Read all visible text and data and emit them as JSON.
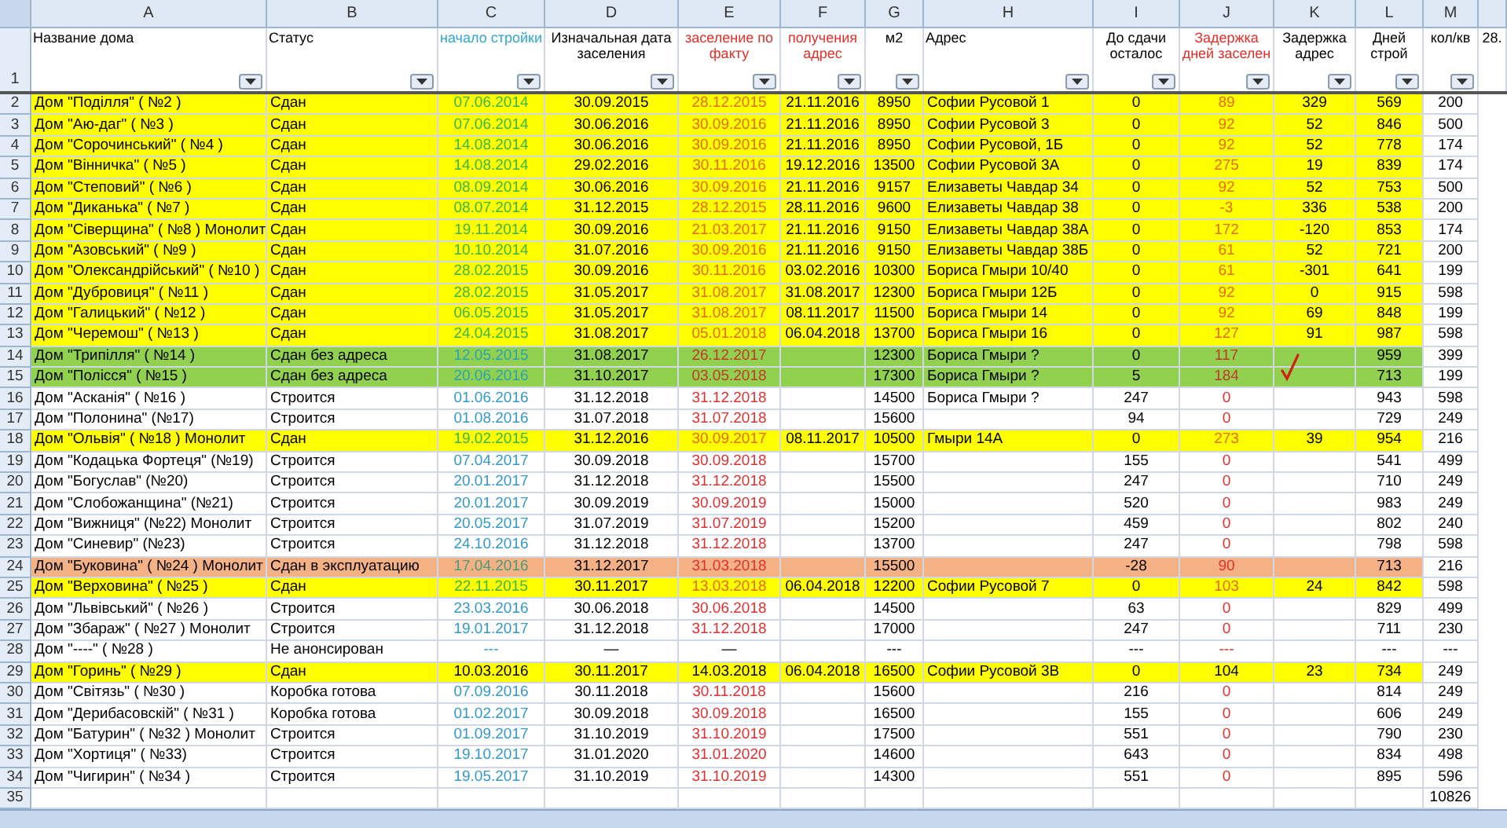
{
  "header_row_number": "1",
  "columns": [
    {
      "letter": "A",
      "label": "Название дома",
      "filter": true
    },
    {
      "letter": "B",
      "label": "Статус",
      "filter": true
    },
    {
      "letter": "C",
      "label": "начало стройки",
      "color": "#2ea6d6",
      "filter": true
    },
    {
      "letter": "D",
      "label": "Изначальная дата заселения",
      "filter": true
    },
    {
      "letter": "E",
      "label": "заселение по факту",
      "color": "#e0302a",
      "filter": true
    },
    {
      "letter": "F",
      "label": "получения адрес",
      "color": "#e0302a",
      "filter": true
    },
    {
      "letter": "G",
      "label": "м2",
      "filter": true
    },
    {
      "letter": "H",
      "label": "Адрес",
      "filter": true
    },
    {
      "letter": "I",
      "label": "До сдачи осталос",
      "filter": true
    },
    {
      "letter": "J",
      "label": "Задержка дней заселен",
      "color": "#e0302a",
      "filter": true
    },
    {
      "letter": "K",
      "label": "Задержка адрес",
      "filter": true
    },
    {
      "letter": "L",
      "label": "Дней строй",
      "filter": true
    },
    {
      "letter": "M",
      "label": "кол/кв",
      "filter": true
    },
    {
      "label": "28.",
      "filter": false
    }
  ],
  "rows": [
    {
      "row": "2",
      "kind": "handed",
      "tick": false,
      "cells": {
        "A": "Дом \"Поділля\" ( №2 )",
        "B": "Сдан",
        "C": "07.06.2014",
        "D": "30.09.2015",
        "E": "28.12.2015",
        "F": "21.11.2016",
        "G": "8950",
        "H": "Софии Русовой 1",
        "I": "0",
        "J": "89",
        "K": "329",
        "L": "569",
        "M": "200"
      }
    },
    {
      "row": "3",
      "kind": "handed",
      "tick": false,
      "cells": {
        "A": "Дом \"Аю-даг\" ( №3 )",
        "B": "Сдан",
        "C": "07.06.2014",
        "D": "30.06.2016",
        "E": "30.09.2016",
        "F": "21.11.2016",
        "G": "8950",
        "H": "Софии Русовой 3",
        "I": "0",
        "J": "92",
        "K": "52",
        "L": "846",
        "M": "500"
      }
    },
    {
      "row": "4",
      "kind": "handed",
      "tick": false,
      "cells": {
        "A": "Дом \"Сорочинський\" ( №4 )",
        "B": "Сдан",
        "C": "14.08.2014",
        "D": "30.06.2016",
        "E": "30.09.2016",
        "F": "21.11.2016",
        "G": "8950",
        "H": "Софии Русовой, 1Б",
        "I": "0",
        "J": "92",
        "K": "52",
        "L": "778",
        "M": "174"
      }
    },
    {
      "row": "5",
      "kind": "handed",
      "tick": false,
      "cells": {
        "A": "Дом \"Вінничка\" ( №5 )",
        "B": "Сдан",
        "C": "14.08.2014",
        "D": "29.02.2016",
        "E": "30.11.2016",
        "F": "19.12.2016",
        "G": "13500",
        "H": "Софии Русовой 3А",
        "I": "0",
        "J": "275",
        "K": "19",
        "L": "839",
        "M": "174"
      }
    },
    {
      "row": "6",
      "kind": "handed",
      "tick": false,
      "cells": {
        "A": "Дом \"Степовий\" ( №6 )",
        "B": "Сдан",
        "C": "08.09.2014",
        "D": "30.06.2016",
        "E": "30.09.2016",
        "F": "21.11.2016",
        "G": "9157",
        "H": "Елизаветы Чавдар 34",
        "I": "0",
        "J": "92",
        "K": "52",
        "L": "753",
        "M": "500"
      }
    },
    {
      "row": "7",
      "kind": "handed",
      "tick": false,
      "cells": {
        "A": "Дом \"Диканька\" ( №7 )",
        "B": "Сдан",
        "C": "08.07.2014",
        "D": "31.12.2015",
        "E": "28.12.2015",
        "F": "28.11.2016",
        "G": "9600",
        "H": "Елизаветы Чавдар 38",
        "I": "0",
        "J": "-3",
        "K": "336",
        "L": "538",
        "M": "200"
      }
    },
    {
      "row": "8",
      "kind": "handed",
      "tick": false,
      "cells": {
        "A": "Дом \"Сіверщина\" ( №8 ) Монолит",
        "B": "Сдан",
        "C": "19.11.2014",
        "D": "30.09.2016",
        "E": "21.03.2017",
        "F": "21.11.2016",
        "G": "9150",
        "H": "Елизаветы Чавдар 38А",
        "I": "0",
        "J": "172",
        "K": "-120",
        "L": "853",
        "M": "174"
      }
    },
    {
      "row": "9",
      "kind": "handed",
      "tick": false,
      "cells": {
        "A": "Дом \"Азовський\" ( №9 )",
        "B": "Сдан",
        "C": "10.10.2014",
        "D": "31.07.2016",
        "E": "30.09.2016",
        "F": "21.11.2016",
        "G": "9150",
        "H": "Елизаветы Чавдар 38Б",
        "I": "0",
        "J": "61",
        "K": "52",
        "L": "721",
        "M": "200"
      }
    },
    {
      "row": "10",
      "kind": "handed",
      "tick": false,
      "cells": {
        "A": "Дом \"Олександрійський\" ( №10 )",
        "B": "Сдан",
        "C": "28.02.2015",
        "D": "30.09.2016",
        "E": "30.11.2016",
        "F": "03.02.2016",
        "G": "10300",
        "H": "Бориса Гмыри 10/40",
        "I": "0",
        "J": "61",
        "K": "-301",
        "L": "641",
        "M": "199"
      }
    },
    {
      "row": "11",
      "kind": "handed",
      "tick": false,
      "cells": {
        "A": "Дом \"Дубровиця\" ( №11 )",
        "B": "Сдан",
        "C": "28.02.2015",
        "D": "31.05.2017",
        "E": "31.08.2017",
        "F": "31.08.2017",
        "G": "12300",
        "H": "Бориса Гмыри 12Б",
        "I": "0",
        "J": "92",
        "K": "0",
        "L": "915",
        "M": "598"
      }
    },
    {
      "row": "12",
      "kind": "handed",
      "tick": false,
      "cells": {
        "A": "Дом \"Галицький\" ( №12 )",
        "B": "Сдан",
        "C": "06.05.2015",
        "D": "31.05.2017",
        "E": "31.08.2017",
        "F": "08.11.2017",
        "G": "11500",
        "H": "Бориса Гмыри 14",
        "I": "0",
        "J": "92",
        "K": "69",
        "L": "848",
        "M": "199"
      }
    },
    {
      "row": "13",
      "kind": "handed",
      "tick": false,
      "cells": {
        "A": "Дом \"Черемош\" ( №13 )",
        "B": "Сдан",
        "C": "24.04.2015",
        "D": "31.08.2017",
        "E": "05.01.2018",
        "F": "06.04.2018",
        "G": "13700",
        "H": "Бориса Гмыри 16",
        "I": "0",
        "J": "127",
        "K": "91",
        "L": "987",
        "M": "598"
      }
    },
    {
      "row": "14",
      "kind": "no_address",
      "tick": false,
      "cells": {
        "A": "Дом \"Трипілля\" ( №14 )",
        "B": "Сдан без адреса",
        "C": "12.05.2015",
        "D": "31.08.2017",
        "E": "26.12.2017",
        "G": "12300",
        "H": "Бориса Гмыри ?",
        "I": "0",
        "J": "117",
        "L": "959",
        "M": "399"
      }
    },
    {
      "row": "15",
      "kind": "no_address",
      "tick": true,
      "cells": {
        "A": "Дом \"Полісся\" ( №15 )",
        "B": "Сдан без адреса",
        "C": "20.06.2016",
        "D": "31.10.2017",
        "E": "03.05.2018",
        "G": "17300",
        "H": "Бориса Гмыри ?",
        "I": "5",
        "J": "184",
        "L": "713",
        "M": "199"
      }
    },
    {
      "row": "16",
      "kind": "building",
      "tick": false,
      "cells": {
        "A": "Дом \"Асканія\" ( №16 )",
        "B": "Строится",
        "C": "01.06.2016",
        "D": "31.12.2018",
        "E": "31.12.2018",
        "G": "14500",
        "H": "Бориса Гмыри ?",
        "I": "247",
        "J": "0",
        "L": "943",
        "M": "598"
      }
    },
    {
      "row": "17",
      "kind": "building",
      "tick": false,
      "cells": {
        "A": "Дом \"Полонина\" (№17)",
        "B": "Строится",
        "C": "01.08.2016",
        "D": "31.07.2018",
        "E": "31.07.2018",
        "G": "15600",
        "I": "94",
        "J": "0",
        "L": "729",
        "M": "249"
      }
    },
    {
      "row": "18",
      "kind": "handed",
      "tick": false,
      "cells": {
        "A": "Дом \"Ольвія\" ( №18 ) Монолит",
        "B": "Сдан",
        "C": "19.02.2015",
        "D": "31.12.2016",
        "E": "30.09.2017",
        "F": "08.11.2017",
        "G": "10500",
        "H": "Гмыри 14А",
        "I": "0",
        "J": "273",
        "K": "39",
        "L": "954",
        "M": "216"
      }
    },
    {
      "row": "19",
      "kind": "building",
      "tick": false,
      "cells": {
        "A": "Дом \"Кодацька Фортеця\" (№19)",
        "B": "Строится",
        "C": "07.04.2017",
        "D": "30.09.2018",
        "E": "30.09.2018",
        "G": "15700",
        "I": "155",
        "J": "0",
        "L": "541",
        "M": "499"
      }
    },
    {
      "row": "20",
      "kind": "building",
      "tick": false,
      "cells": {
        "A": "Дом \"Богуслав\" (№20)",
        "B": "Строится",
        "C": "20.01.2017",
        "D": "31.12.2018",
        "E": "31.12.2018",
        "G": "15500",
        "I": "247",
        "J": "0",
        "L": "710",
        "M": "249"
      }
    },
    {
      "row": "21",
      "kind": "building",
      "tick": false,
      "cells": {
        "A": "Дом \"Слобожанщина\" (№21)",
        "B": "Строится",
        "C": "20.01.2017",
        "D": "30.09.2019",
        "E": "30.09.2019",
        "G": "15000",
        "I": "520",
        "J": "0",
        "L": "983",
        "M": "249"
      }
    },
    {
      "row": "22",
      "kind": "building",
      "tick": false,
      "cells": {
        "A": "Дом \"Вижниця\" (№22) Монолит",
        "B": "Строится",
        "C": "20.05.2017",
        "D": "31.07.2019",
        "E": "31.07.2019",
        "G": "15200",
        "I": "459",
        "J": "0",
        "L": "802",
        "M": "240"
      }
    },
    {
      "row": "23",
      "kind": "building",
      "tick": false,
      "cells": {
        "A": "Дом \"Синевир\" (№23)",
        "B": "Строится",
        "C": "24.10.2016",
        "D": "31.12.2018",
        "E": "31.12.2018",
        "G": "13700",
        "I": "247",
        "J": "0",
        "L": "798",
        "M": "598"
      }
    },
    {
      "row": "24",
      "kind": "commissioned",
      "tick": false,
      "cells": {
        "A": "Дом \"Буковина\" ( №24 ) Монолит",
        "B": "Сдан в эксплуатацию",
        "C": "17.04.2016",
        "D": "31.12.2017",
        "E": "31.03.2018",
        "G": "15500",
        "I": "-28",
        "J": "90",
        "L": "713",
        "M": "216"
      }
    },
    {
      "row": "25",
      "kind": "handed",
      "tick": false,
      "cells": {
        "A": "Дом \"Верховина\" ( №25 )",
        "B": "Сдан",
        "C": "22.11.2015",
        "D": "30.11.2017",
        "E": "13.03.2018",
        "F": "06.04.2018",
        "G": "12200",
        "H": "Софии Русовой 7",
        "I": "0",
        "J": "103",
        "K": "24",
        "L": "842",
        "M": "598"
      }
    },
    {
      "row": "26",
      "kind": "building",
      "tick": false,
      "cells": {
        "A": "Дом \"Львівський\" ( №26 )",
        "B": "Строится",
        "C": "23.03.2016",
        "D": "30.06.2018",
        "E": "30.06.2018",
        "G": "14500",
        "I": "63",
        "J": "0",
        "L": "829",
        "M": "499"
      }
    },
    {
      "row": "27",
      "kind": "building",
      "tick": false,
      "cells": {
        "A": "Дом \"Збараж\" ( №27 ) Монолит",
        "B": "Строится",
        "C": "19.01.2017",
        "D": "31.12.2018",
        "E": "31.12.2018",
        "G": "17000",
        "I": "247",
        "J": "0",
        "L": "711",
        "M": "230"
      }
    },
    {
      "row": "28",
      "kind": "unannounced",
      "tick": false,
      "cells": {
        "A": "Дом \"----\" ( №28 )",
        "B": "Не анонсирован",
        "C": "---",
        "D": "—",
        "E": "—",
        "G": "---",
        "I": "---",
        "J": "---",
        "L": "---",
        "M": "---"
      }
    },
    {
      "row": "29",
      "kind": "handed_plain",
      "tick": false,
      "cells": {
        "A": "Дом \"Горинь\" ( №29 )",
        "B": "Сдан",
        "C": "10.03.2016",
        "D": "30.11.2017",
        "E": "14.03.2018",
        "F": "06.04.2018",
        "G": "16500",
        "H": "Софии Русовой 3В",
        "I": "0",
        "J": "104",
        "K": "23",
        "L": "734",
        "M": "249"
      }
    },
    {
      "row": "30",
      "kind": "building",
      "tick": false,
      "cells": {
        "A": "Дом \"Світязь\" ( №30 )",
        "B": "Коробка готова",
        "C": "07.09.2016",
        "D": "30.11.2018",
        "E": "30.11.2018",
        "G": "15600",
        "I": "216",
        "J": "0",
        "L": "814",
        "M": "249"
      }
    },
    {
      "row": "31",
      "kind": "building",
      "tick": false,
      "cells": {
        "A": "Дом \"Дерибасовскій\" ( №31 )",
        "B": "Коробка готова",
        "C": "01.02.2017",
        "D": "30.09.2018",
        "E": "30.09.2018",
        "G": "16500",
        "I": "155",
        "J": "0",
        "L": "606",
        "M": "249"
      }
    },
    {
      "row": "32",
      "kind": "building",
      "tick": false,
      "cells": {
        "A": "Дом \"Батурин\" ( №32 ) Монолит",
        "B": "Строится",
        "C": "01.09.2017",
        "D": "31.10.2019",
        "E": "31.10.2019",
        "G": "17500",
        "I": "551",
        "J": "0",
        "L": "790",
        "M": "230"
      }
    },
    {
      "row": "33",
      "kind": "building",
      "tick": false,
      "cells": {
        "A": "Дом \"Хортиця\" ( №33)",
        "B": "Строится",
        "C": "19.10.2017",
        "D": "31.01.2020",
        "E": "31.01.2020",
        "G": "14600",
        "I": "643",
        "J": "0",
        "L": "834",
        "M": "498"
      }
    },
    {
      "row": "34",
      "kind": "building",
      "tick": false,
      "cells": {
        "A": "Дом \"Чигирин\"  ( №34 )",
        "B": "Строится",
        "C": "19.05.2017",
        "D": "31.10.2019",
        "E": "31.10.2019",
        "G": "14300",
        "I": "551",
        "J": "0",
        "L": "895",
        "M": "596"
      }
    },
    {
      "row": "35",
      "kind": "blank",
      "tick": false,
      "cells": {
        "M": "10826"
      }
    }
  ]
}
